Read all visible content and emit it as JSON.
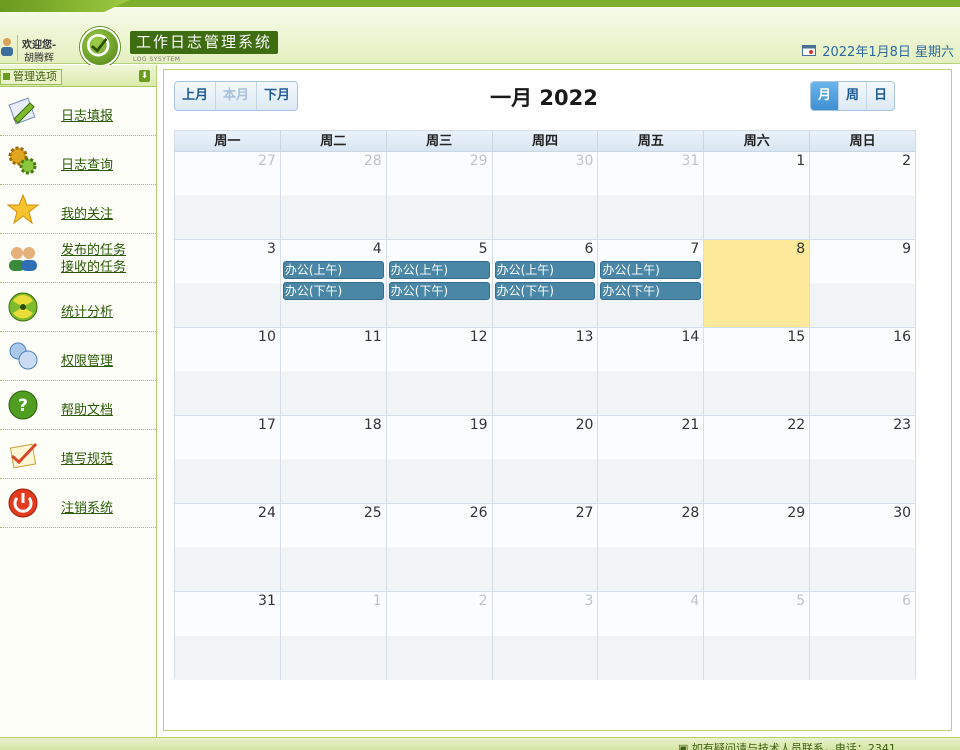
{
  "header": {
    "welcome_text": "欢迎您-",
    "user_name": "胡腾辉",
    "system_title": "工作日志管理系统",
    "system_subtitle": "LOG SYSYTEM",
    "date_text": "2022年1月8日 星期六"
  },
  "sidebar": {
    "section_label": "管理选项",
    "items": [
      {
        "label": "日志填报",
        "icon": "pencil-paper-icon"
      },
      {
        "label": "日志查询",
        "icon": "gears-icon"
      },
      {
        "label": "我的关注",
        "icon": "star-icon"
      },
      {
        "label": "发布的任务",
        "label2": "接收的任务",
        "icon": "users-icon"
      },
      {
        "label": "统计分析",
        "icon": "radiation-icon"
      },
      {
        "label": "权限管理",
        "icon": "user-group-icon"
      },
      {
        "label": "帮助文档",
        "icon": "help-icon"
      },
      {
        "label": "填写规范",
        "icon": "checklist-icon"
      },
      {
        "label": "注销系统",
        "icon": "power-icon"
      }
    ]
  },
  "calendar": {
    "prev_label": "上月",
    "today_label": "本月",
    "next_label": "下月",
    "title": "一月 2022",
    "view_month": "月",
    "view_week": "周",
    "view_day": "日",
    "weekdays": [
      "周一",
      "周二",
      "周三",
      "周四",
      "周五",
      "周六",
      "周日"
    ],
    "weeks": [
      [
        {
          "n": "27",
          "other": true
        },
        {
          "n": "28",
          "other": true
        },
        {
          "n": "29",
          "other": true
        },
        {
          "n": "30",
          "other": true
        },
        {
          "n": "31",
          "other": true
        },
        {
          "n": "1"
        },
        {
          "n": "2"
        }
      ],
      [
        {
          "n": "3"
        },
        {
          "n": "4",
          "events": [
            "办公(上午)",
            "办公(下午)"
          ]
        },
        {
          "n": "5",
          "events": [
            "办公(上午)",
            "办公(下午)"
          ]
        },
        {
          "n": "6",
          "events": [
            "办公(上午)",
            "办公(下午)"
          ]
        },
        {
          "n": "7",
          "events": [
            "办公(上午)",
            "办公(下午)"
          ]
        },
        {
          "n": "8",
          "today": true
        },
        {
          "n": "9"
        }
      ],
      [
        {
          "n": "10"
        },
        {
          "n": "11"
        },
        {
          "n": "12"
        },
        {
          "n": "13"
        },
        {
          "n": "14"
        },
        {
          "n": "15"
        },
        {
          "n": "16"
        }
      ],
      [
        {
          "n": "17"
        },
        {
          "n": "18"
        },
        {
          "n": "19"
        },
        {
          "n": "20"
        },
        {
          "n": "21"
        },
        {
          "n": "22"
        },
        {
          "n": "23"
        }
      ],
      [
        {
          "n": "24"
        },
        {
          "n": "25"
        },
        {
          "n": "26"
        },
        {
          "n": "27"
        },
        {
          "n": "28"
        },
        {
          "n": "29"
        },
        {
          "n": "30"
        }
      ],
      [
        {
          "n": "31"
        },
        {
          "n": "1",
          "other": true
        },
        {
          "n": "2",
          "other": true
        },
        {
          "n": "3",
          "other": true
        },
        {
          "n": "4",
          "other": true
        },
        {
          "n": "5",
          "other": true
        },
        {
          "n": "6",
          "other": true
        }
      ]
    ]
  },
  "footer": {
    "text": "如有疑问请与技术人员联系，电话：2341"
  },
  "colors": {
    "brand_green": "#7fae2b",
    "event_blue": "#4a86a6",
    "today_yellow": "#fde99a",
    "button_blue": "#3f8fd2"
  }
}
